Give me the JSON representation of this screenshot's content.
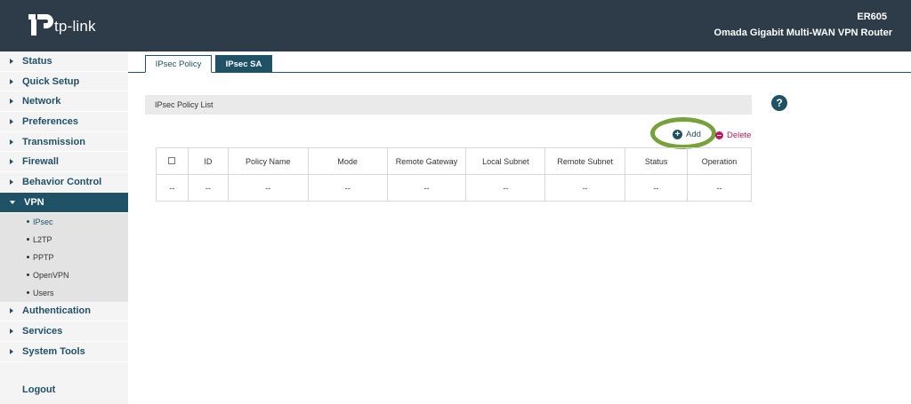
{
  "header": {
    "brand": "tp-link",
    "model": "ER605",
    "product": "Omada Gigabit Multi-WAN VPN Router"
  },
  "sidebar": {
    "items_top": [
      {
        "label": "Status"
      },
      {
        "label": "Quick Setup"
      },
      {
        "label": "Network"
      },
      {
        "label": "Preferences"
      },
      {
        "label": "Transmission"
      },
      {
        "label": "Firewall"
      },
      {
        "label": "Behavior Control"
      }
    ],
    "active": {
      "label": "VPN"
    },
    "sub_items": [
      {
        "label": "IPsec"
      },
      {
        "label": "L2TP"
      },
      {
        "label": "PPTP"
      },
      {
        "label": "OpenVPN"
      },
      {
        "label": "Users"
      }
    ],
    "items_bottom": [
      {
        "label": "Authentication"
      },
      {
        "label": "Services"
      },
      {
        "label": "System Tools"
      }
    ],
    "logout": "Logout"
  },
  "tabs": [
    {
      "label": "IPsec Policy"
    },
    {
      "label": "IPsec SA"
    }
  ],
  "section": {
    "title": "IPsec Policy List",
    "help": "?"
  },
  "actions": {
    "add": "Add",
    "delete": "Delete"
  },
  "table": {
    "columns": [
      "ID",
      "Policy Name",
      "Mode",
      "Remote Gateway",
      "Local Subnet",
      "Remote Subnet",
      "Status",
      "Operation"
    ],
    "row": [
      "--",
      "--",
      "--",
      "--",
      "--",
      "--",
      "--",
      "--",
      "--"
    ]
  },
  "colors": {
    "header_bg": "#2d3c48",
    "brand_teal": "#1f5167",
    "highlight": "#77a13b",
    "delete": "#c2185b"
  }
}
